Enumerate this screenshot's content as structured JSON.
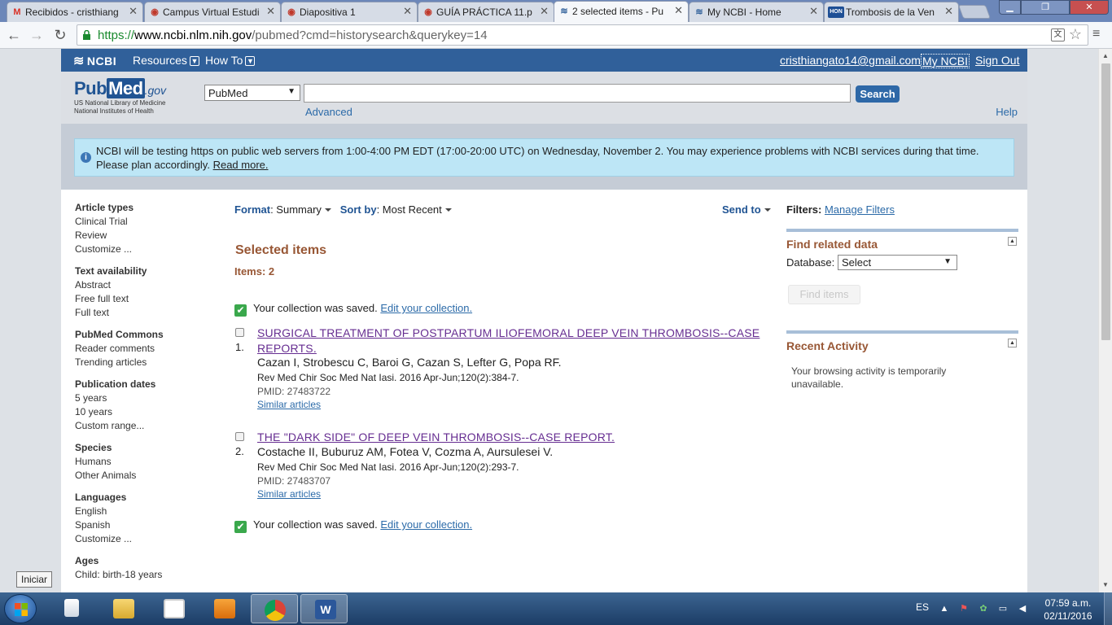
{
  "browser": {
    "tabs": [
      {
        "icon": "gmail-icon",
        "fav": "M",
        "title": "Recibidos - cristhiang",
        "active": false
      },
      {
        "icon": "campus-icon",
        "fav": "◉",
        "title": "Campus Virtual Estudi",
        "active": false
      },
      {
        "icon": "campus-icon",
        "fav": "◉",
        "title": "Diapositiva 1",
        "active": false
      },
      {
        "icon": "campus-icon",
        "fav": "◉",
        "title": "GUÍA PRÁCTICA 11.p",
        "active": false
      },
      {
        "icon": "ncbi-icon",
        "fav": "≋",
        "title": "2 selected items - Pu",
        "active": true
      },
      {
        "icon": "ncbi-icon",
        "fav": "≋",
        "title": "My NCBI - Home",
        "active": false
      },
      {
        "icon": "hon-icon",
        "fav": "HON",
        "title": "Trombosis de la Ven",
        "active": false
      }
    ],
    "url_scheme": "https://",
    "url_domain": "www.ncbi.nlm.nih.gov",
    "url_path": "/pubmed?cmd=historysearch&querykey=14"
  },
  "ncbi": {
    "logo": "NCBI",
    "menu_resources": "Resources",
    "menu_howto": "How To",
    "user_email": "cristhiangato14@gmail.com",
    "my_ncbi": "My NCBI",
    "sign_out": "Sign Out"
  },
  "search": {
    "logo_pub": "Pub",
    "logo_med": "Med",
    "logo_gov": ".gov",
    "logo_sub1": "US National Library of Medicine",
    "logo_sub2": "National Institutes of Health",
    "database": "PubMed",
    "term": "",
    "button": "Search",
    "advanced": "Advanced",
    "help": "Help"
  },
  "notice": {
    "text": "NCBI will be testing https on public web servers from 1:00-4:00 PM EDT (17:00-20:00 UTC) on Wednesday, November 2. You may experience problems with NCBI services during that time. Please plan accordingly.",
    "link": "Read more."
  },
  "facets": [
    {
      "head": "Article types",
      "items": [
        "Clinical Trial",
        "Review",
        "Customize ..."
      ]
    },
    {
      "head": "Text availability",
      "items": [
        "Abstract",
        "Free full text",
        "Full text"
      ]
    },
    {
      "head": "PubMed Commons",
      "items": [
        "Reader comments",
        "Trending articles"
      ]
    },
    {
      "head": "Publication dates",
      "items": [
        "5 years",
        "10 years",
        "Custom range..."
      ]
    },
    {
      "head": "Species",
      "items": [
        "Humans",
        "Other Animals"
      ]
    },
    {
      "head": "Languages",
      "items": [
        "English",
        "Spanish",
        "Customize ..."
      ]
    },
    {
      "head": "Ages",
      "items": [
        "Child: birth-18 years"
      ]
    }
  ],
  "results_bar": {
    "format_label": "Format",
    "format_value": "Summary",
    "sort_label": "Sort by",
    "sort_value": "Most Recent",
    "send_to": "Send to"
  },
  "selection": {
    "title": "Selected items",
    "count": "Items: 2",
    "saved_msg": "Your collection was saved.",
    "saved_link": "Edit your collection."
  },
  "results": [
    {
      "num": "1.",
      "title": "SURGICAL TREATMENT OF POSTPARTUM ILIOFEMORAL DEEP VEIN THROMBOSIS--CASE REPORTS.",
      "authors": "Cazan I, Strobescu C, Baroi G, Cazan S, Lefter G, Popa RF.",
      "journal": "Rev Med Chir Soc Med Nat Iasi. 2016 Apr-Jun;120(2):384-7.",
      "pmid": "PMID: 27483722",
      "similar": "Similar articles"
    },
    {
      "num": "2.",
      "title": "THE \"DARK SIDE\" OF DEEP VEIN THROMBOSIS--CASE REPORT.",
      "authors": "Costache II, Buburuz AM, Fotea V, Cozma A, Aursulesei V.",
      "journal": "Rev Med Chir Soc Med Nat Iasi. 2016 Apr-Jun;120(2):293-7.",
      "pmid": "PMID: 27483707",
      "similar": "Similar articles"
    }
  ],
  "right": {
    "filters_label": "Filters:",
    "manage_filters": "Manage Filters",
    "find_related": "Find related data",
    "database_label": "Database:",
    "database_value": "Select",
    "find_items": "Find items",
    "recent_activity": "Recent Activity",
    "activity_text": "Your browsing activity is temporarily unavailable."
  },
  "tooltip": "Iniciar",
  "taskbar": {
    "lang": "ES",
    "time": "07:59 a.m.",
    "date": "02/11/2016"
  },
  "colors": {
    "ncbi_bar": "#30609a",
    "accent_title": "#985735",
    "link": "#2b6aa8",
    "visited": "#662d91",
    "notice_bg": "#bde6f6"
  }
}
